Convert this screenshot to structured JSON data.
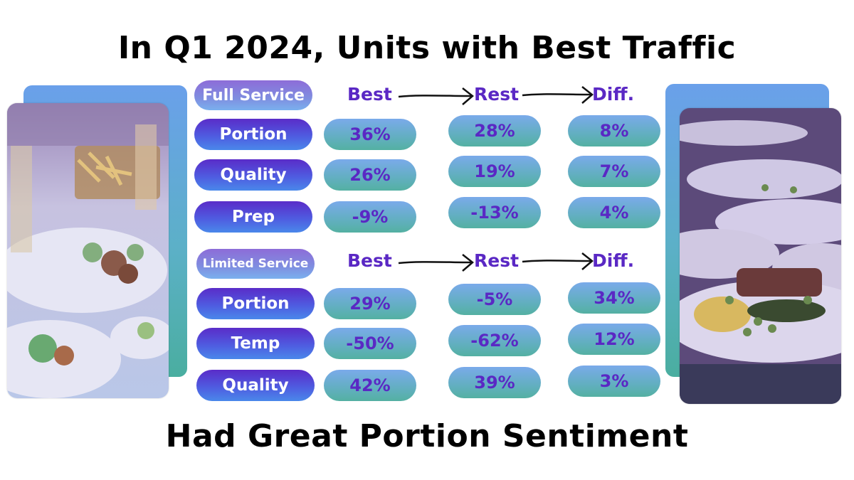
{
  "title_top": "In Q1 2024, Units with Best Traffic",
  "title_bottom": "Had Great Portion Sentiment",
  "columns": [
    "Best",
    "Rest",
    "Diff."
  ],
  "colors": {
    "value_text": "#5a28c4",
    "label_pill": "#4f5be0",
    "value_pill": "#62afc0"
  },
  "sections": [
    {
      "name": "Full Service",
      "rows": [
        {
          "label": "Portion",
          "best": "36%",
          "rest": "28%",
          "diff": "8%"
        },
        {
          "label": "Quality",
          "best": "26%",
          "rest": "19%",
          "diff": "7%"
        },
        {
          "label": "Prep",
          "best": "-9%",
          "rest": "-13%",
          "diff": "4%"
        }
      ]
    },
    {
      "name": "Limited Service",
      "rows": [
        {
          "label": "Portion",
          "best": "29%",
          "rest": "-5%",
          "diff": "34%"
        },
        {
          "label": "Temp",
          "best": "-50%",
          "rest": "-62%",
          "diff": "12%"
        },
        {
          "label": "Quality",
          "best": "42%",
          "rest": "39%",
          "diff": "3%"
        }
      ]
    }
  ],
  "images": {
    "left": "restaurant-table-food-photo",
    "right": "plated-dishes-photo"
  }
}
